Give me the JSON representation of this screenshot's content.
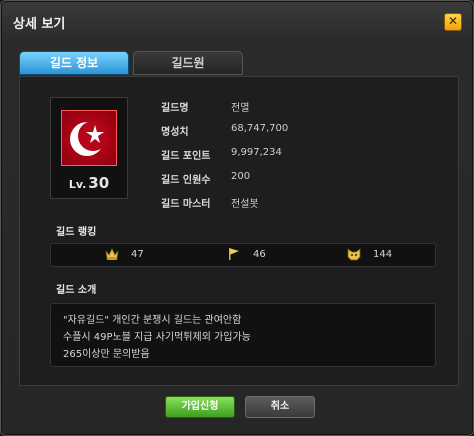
{
  "window": {
    "title": "상세 보기",
    "close_glyph": "✕"
  },
  "tabs": [
    {
      "label": "길드 정보",
      "active": true
    },
    {
      "label": "길드원",
      "active": false
    }
  ],
  "guild": {
    "level_prefix": "Lv.",
    "level": "30",
    "info": [
      {
        "label": "길드명",
        "value": "전멸"
      },
      {
        "label": "명성치",
        "value": "68,747,700"
      },
      {
        "label": "길드 포인트",
        "value": "9,997,234"
      },
      {
        "label": "길드 인원수",
        "value": "200"
      },
      {
        "label": "길드 마스터",
        "value": "전설봇"
      }
    ],
    "emblem_icon": "crescent-star-emblem-icon"
  },
  "ranking": {
    "label": "길드 랭킹",
    "items": [
      {
        "icon": "crown-icon",
        "value": "47"
      },
      {
        "icon": "flag-icon",
        "value": "46"
      },
      {
        "icon": "cat-face-icon",
        "value": "144"
      }
    ]
  },
  "intro": {
    "label": "길드 소개",
    "lines": [
      "\"자유길드\" 개인간 분쟁시 길드는 관여안함",
      "수플시 49P노블 지급 사기먹튀제외 가입가능",
      "265이상만 문의받음"
    ]
  },
  "buttons": {
    "apply": "가입신청",
    "cancel": "취소"
  },
  "colors": {
    "accent_tab": "#2b93d3",
    "apply_button": "#3d9f1f",
    "close_button": "#f0a400",
    "emblem": "#c5081a"
  }
}
